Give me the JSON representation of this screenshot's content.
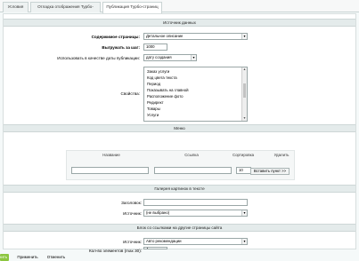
{
  "tabs": [
    "Условия",
    "Отладка отображения Турбо-страницы",
    "Публикация Турбо-страниц"
  ],
  "sections": {
    "data_source": {
      "title": "Источник данных",
      "page_content_label": "Содержимое страницы:",
      "page_content_value": "Детальное описание",
      "unload_label": "Выгружать за шаг:",
      "unload_value": "1000",
      "pubdate_label": "Использовать в качестве даты публикации:",
      "pubdate_value": "дату создания",
      "properties_label": "Свойства:",
      "properties_items": [
        "Заказ услуги",
        "Код цвета текста",
        "Период",
        "Показывать на главной",
        "Расположение фото",
        "Редирект",
        "Товары",
        "Услуги"
      ]
    },
    "menu": {
      "title": "Меню",
      "col_name": "Название",
      "col_link": "Ссылка",
      "col_sort": "Сортировка",
      "col_delete": "Удалить",
      "row_sort_value": "10",
      "insert_button": "Вставить пункт >>"
    },
    "gallery": {
      "title": "Галерея картинок в тексте",
      "heading_label": "Заголовок:",
      "source_label": "Источник:",
      "source_value": "(не выбрано)"
    },
    "links": {
      "title": "Блок со ссылками на другие страницы сайта",
      "source_label": "Источник:",
      "source_value": "Авто рекомендации",
      "count_label": "Кол-во элементов (max 30):",
      "count_value": "4"
    }
  },
  "footer": {
    "save": "Сохранить",
    "apply": "Применить",
    "cancel": "Отменить"
  }
}
